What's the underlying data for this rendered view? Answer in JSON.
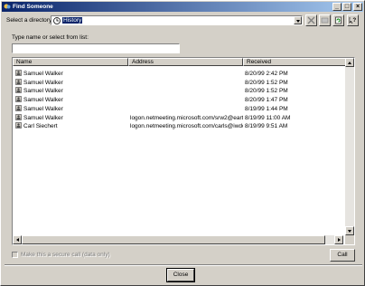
{
  "window": {
    "title": "Find Someone",
    "controls": {
      "minimize": "_",
      "maximize": "□",
      "close": "×"
    }
  },
  "directory": {
    "label": "Select a directory:",
    "selected": "History"
  },
  "toolbar": {
    "icons": [
      "stop-icon",
      "properties-icon",
      "refresh-icon",
      "help-icon"
    ]
  },
  "search": {
    "label": "Type name or select from list:",
    "value": ""
  },
  "list": {
    "columns": [
      "Name",
      "Address",
      "Received"
    ],
    "rows": [
      {
        "name": "Samuel Walker",
        "address": "",
        "received": "8/20/99 2:42 PM"
      },
      {
        "name": "Samuel Walker",
        "address": "",
        "received": "8/20/99 1:52 PM"
      },
      {
        "name": "Samuel Walker",
        "address": "",
        "received": "8/20/99 1:52 PM"
      },
      {
        "name": "Samuel Walker",
        "address": "",
        "received": "8/20/99 1:47 PM"
      },
      {
        "name": "Samuel Walker",
        "address": "",
        "received": "8/19/99 1:44 PM"
      },
      {
        "name": "Samuel Walker",
        "address": "logon.netmeeting.microsoft.com/srw2@earth...",
        "received": "8/19/99 11:00 AM"
      },
      {
        "name": "Carl Siechert",
        "address": "logon.netmeeting.microsoft.com/carls@iwdo...",
        "received": "8/19/99 9:51 AM"
      }
    ]
  },
  "secure_call": {
    "label": "Make this a secure call (data only)",
    "checked": false,
    "enabled": false
  },
  "buttons": {
    "call": "Call",
    "close": "Close"
  }
}
